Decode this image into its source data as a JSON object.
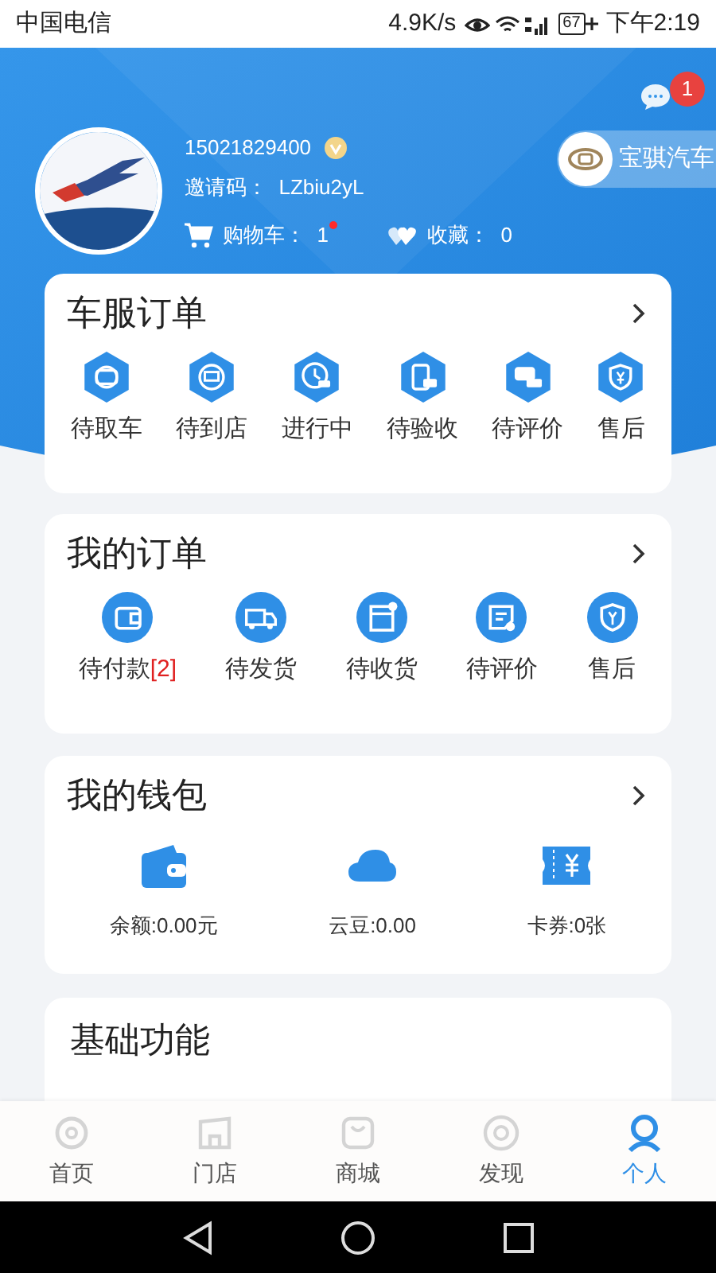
{
  "status_bar": {
    "carrier": "中国电信",
    "speed": "4.9K/s",
    "battery": "67",
    "time": "下午2:19"
  },
  "header": {
    "message_badge": "1",
    "brand": "宝骐汽车"
  },
  "profile": {
    "phone": "15021829400",
    "invite": "邀请码：  LZbiu2yL",
    "cart": "购物车：  1",
    "cart_dot": true,
    "favorites": "收藏：  0"
  },
  "sections": [
    {
      "title": "车服订单",
      "items": [
        {
          "label": "待取车"
        },
        {
          "label": "待到店"
        },
        {
          "label": "进行中"
        },
        {
          "label": "待验收"
        },
        {
          "label": "待评价"
        },
        {
          "label": "售后"
        }
      ]
    },
    {
      "title": "我的订单",
      "items": [
        {
          "label": "待付款",
          "count": "[2]"
        },
        {
          "label": "待发货"
        },
        {
          "label": "待收货"
        },
        {
          "label": "待评价"
        },
        {
          "label": "售后"
        }
      ]
    },
    {
      "title": "我的钱包",
      "items": [
        {
          "label": "余额:0.00元"
        },
        {
          "label": "云豆:0.00"
        },
        {
          "label": "卡券:0张"
        }
      ]
    }
  ],
  "basic": {
    "title": "基础功能"
  },
  "tabs": [
    {
      "label": "首页",
      "selected": false
    },
    {
      "label": "门店",
      "selected": false
    },
    {
      "label": "商城",
      "selected": false
    },
    {
      "label": "发现",
      "selected": false
    },
    {
      "label": "个人",
      "selected": true
    }
  ]
}
